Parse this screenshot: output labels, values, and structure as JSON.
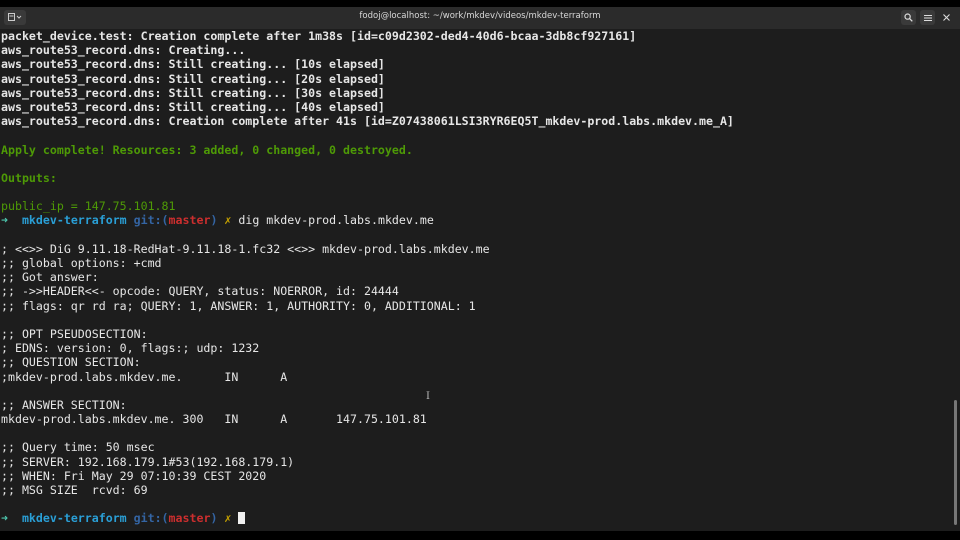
{
  "window": {
    "title": "fodoj@localhost: ~/work/mkdev/videos/mkdev-terraform",
    "menu_icon": "terminal-menu-icon",
    "search_icon": "search-icon",
    "hamburger_icon": "hamburger-menu-icon",
    "close_icon": "close-icon"
  },
  "terminal": {
    "l1": "packet_device.test: Creation complete after 1m38s [id=c09d2302-ded4-40d6-bcaa-3db8cf927161]",
    "l2": "aws_route53_record.dns: Creating...",
    "l3": "aws_route53_record.dns: Still creating... [10s elapsed]",
    "l4": "aws_route53_record.dns: Still creating... [20s elapsed]",
    "l5": "aws_route53_record.dns: Still creating... [30s elapsed]",
    "l6": "aws_route53_record.dns: Still creating... [40s elapsed]",
    "l7": "aws_route53_record.dns: Creation complete after 41s [id=Z07438061LSI3RYR6EQ5T_mkdev-prod.labs.mkdev.me_A]",
    "apply": "Apply complete! Resources: 3 added, 0 changed, 0 destroyed.",
    "outputs": "Outputs:",
    "public_ip": "public_ip = 147.75.101.81",
    "prompt": {
      "arrow": "➜",
      "dir": "mkdev-terraform",
      "git": "git:(",
      "branch": "master",
      "git_close": ")",
      "dirty": "✗",
      "command": "dig mkdev-prod.labs.mkdev.me"
    },
    "dig": [
      "; <<>> DiG 9.11.18-RedHat-9.11.18-1.fc32 <<>> mkdev-prod.labs.mkdev.me",
      ";; global options: +cmd",
      ";; Got answer:",
      ";; ->>HEADER<<- opcode: QUERY, status: NOERROR, id: 24444",
      ";; flags: qr rd ra; QUERY: 1, ANSWER: 1, AUTHORITY: 0, ADDITIONAL: 1",
      "",
      ";; OPT PSEUDOSECTION:",
      "; EDNS: version: 0, flags:; udp: 1232",
      ";; QUESTION SECTION:",
      ";mkdev-prod.labs.mkdev.me.      IN      A",
      "",
      ";; ANSWER SECTION:",
      "mkdev-prod.labs.mkdev.me. 300   IN      A       147.75.101.81",
      "",
      ";; Query time: 50 msec",
      ";; SERVER: 192.168.179.1#53(192.168.179.1)",
      ";; WHEN: Fri May 29 07:10:39 CEST 2020",
      ";; MSG SIZE  rcvd: 69"
    ]
  }
}
